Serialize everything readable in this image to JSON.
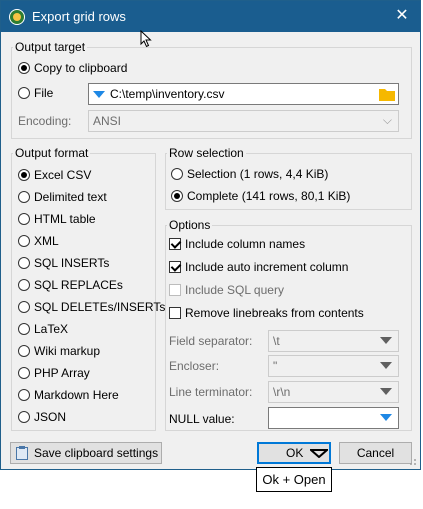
{
  "window": {
    "title": "Export grid rows"
  },
  "output_target": {
    "label": "Output target",
    "copy_to_clipboard": "Copy to clipboard",
    "file": "File",
    "file_path": "C:\\temp\\inventory.csv",
    "encoding_label": "Encoding:",
    "encoding_value": "ANSI"
  },
  "output_format": {
    "label": "Output format",
    "options": [
      "Excel CSV",
      "Delimited text",
      "HTML table",
      "XML",
      "SQL INSERTs",
      "SQL REPLACEs",
      "SQL DELETEs/INSERTs",
      "LaTeX",
      "Wiki markup",
      "PHP Array",
      "Markdown Here",
      "JSON"
    ],
    "selected": "Excel CSV"
  },
  "row_selection": {
    "label": "Row selection",
    "selection": "Selection (1 rows, 4,4 KiB)",
    "complete": "Complete (141 rows, 80,1 KiB)"
  },
  "options": {
    "label": "Options",
    "include_column_names": "Include column names",
    "include_auto_increment": "Include auto increment column",
    "include_sql_query": "Include SQL query",
    "remove_linebreaks": "Remove linebreaks from contents",
    "field_separator_label": "Field separator:",
    "field_separator_value": "\\t",
    "encloser_label": "Encloser:",
    "encloser_value": "\"",
    "line_terminator_label": "Line terminator:",
    "line_terminator_value": "\\r\\n",
    "null_value_label": "NULL value:",
    "null_value_value": ""
  },
  "buttons": {
    "save_clipboard": "Save clipboard settings",
    "ok": "OK",
    "cancel": "Cancel"
  },
  "tooltip": "Ok + Open",
  "colors": {
    "titlebar": "#1a5d8f",
    "accent": "#0078d7",
    "folder": "#f6b800"
  }
}
